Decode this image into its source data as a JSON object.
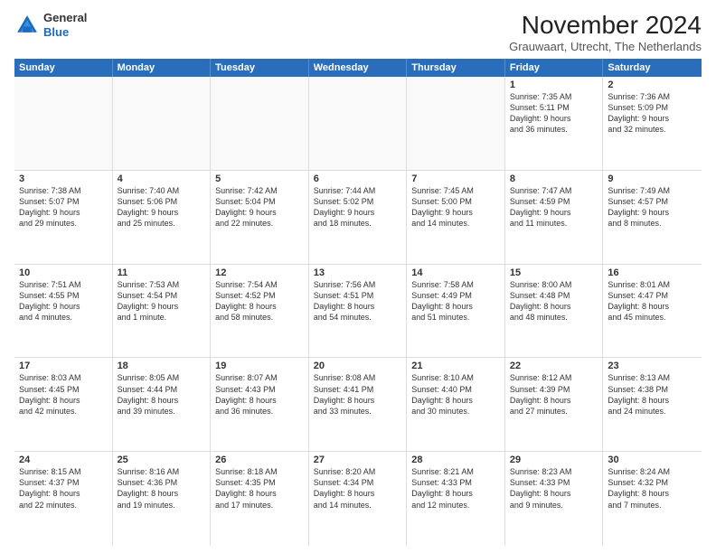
{
  "header": {
    "logo": {
      "line1": "General",
      "line2": "Blue"
    },
    "month_title": "November 2024",
    "subtitle": "Grauwaart, Utrecht, The Netherlands"
  },
  "weekdays": [
    "Sunday",
    "Monday",
    "Tuesday",
    "Wednesday",
    "Thursday",
    "Friday",
    "Saturday"
  ],
  "weeks": [
    [
      {
        "day": "",
        "info": ""
      },
      {
        "day": "",
        "info": ""
      },
      {
        "day": "",
        "info": ""
      },
      {
        "day": "",
        "info": ""
      },
      {
        "day": "",
        "info": ""
      },
      {
        "day": "1",
        "info": "Sunrise: 7:35 AM\nSunset: 5:11 PM\nDaylight: 9 hours\nand 36 minutes."
      },
      {
        "day": "2",
        "info": "Sunrise: 7:36 AM\nSunset: 5:09 PM\nDaylight: 9 hours\nand 32 minutes."
      }
    ],
    [
      {
        "day": "3",
        "info": "Sunrise: 7:38 AM\nSunset: 5:07 PM\nDaylight: 9 hours\nand 29 minutes."
      },
      {
        "day": "4",
        "info": "Sunrise: 7:40 AM\nSunset: 5:06 PM\nDaylight: 9 hours\nand 25 minutes."
      },
      {
        "day": "5",
        "info": "Sunrise: 7:42 AM\nSunset: 5:04 PM\nDaylight: 9 hours\nand 22 minutes."
      },
      {
        "day": "6",
        "info": "Sunrise: 7:44 AM\nSunset: 5:02 PM\nDaylight: 9 hours\nand 18 minutes."
      },
      {
        "day": "7",
        "info": "Sunrise: 7:45 AM\nSunset: 5:00 PM\nDaylight: 9 hours\nand 14 minutes."
      },
      {
        "day": "8",
        "info": "Sunrise: 7:47 AM\nSunset: 4:59 PM\nDaylight: 9 hours\nand 11 minutes."
      },
      {
        "day": "9",
        "info": "Sunrise: 7:49 AM\nSunset: 4:57 PM\nDaylight: 9 hours\nand 8 minutes."
      }
    ],
    [
      {
        "day": "10",
        "info": "Sunrise: 7:51 AM\nSunset: 4:55 PM\nDaylight: 9 hours\nand 4 minutes."
      },
      {
        "day": "11",
        "info": "Sunrise: 7:53 AM\nSunset: 4:54 PM\nDaylight: 9 hours\nand 1 minute."
      },
      {
        "day": "12",
        "info": "Sunrise: 7:54 AM\nSunset: 4:52 PM\nDaylight: 8 hours\nand 58 minutes."
      },
      {
        "day": "13",
        "info": "Sunrise: 7:56 AM\nSunset: 4:51 PM\nDaylight: 8 hours\nand 54 minutes."
      },
      {
        "day": "14",
        "info": "Sunrise: 7:58 AM\nSunset: 4:49 PM\nDaylight: 8 hours\nand 51 minutes."
      },
      {
        "day": "15",
        "info": "Sunrise: 8:00 AM\nSunset: 4:48 PM\nDaylight: 8 hours\nand 48 minutes."
      },
      {
        "day": "16",
        "info": "Sunrise: 8:01 AM\nSunset: 4:47 PM\nDaylight: 8 hours\nand 45 minutes."
      }
    ],
    [
      {
        "day": "17",
        "info": "Sunrise: 8:03 AM\nSunset: 4:45 PM\nDaylight: 8 hours\nand 42 minutes."
      },
      {
        "day": "18",
        "info": "Sunrise: 8:05 AM\nSunset: 4:44 PM\nDaylight: 8 hours\nand 39 minutes."
      },
      {
        "day": "19",
        "info": "Sunrise: 8:07 AM\nSunset: 4:43 PM\nDaylight: 8 hours\nand 36 minutes."
      },
      {
        "day": "20",
        "info": "Sunrise: 8:08 AM\nSunset: 4:41 PM\nDaylight: 8 hours\nand 33 minutes."
      },
      {
        "day": "21",
        "info": "Sunrise: 8:10 AM\nSunset: 4:40 PM\nDaylight: 8 hours\nand 30 minutes."
      },
      {
        "day": "22",
        "info": "Sunrise: 8:12 AM\nSunset: 4:39 PM\nDaylight: 8 hours\nand 27 minutes."
      },
      {
        "day": "23",
        "info": "Sunrise: 8:13 AM\nSunset: 4:38 PM\nDaylight: 8 hours\nand 24 minutes."
      }
    ],
    [
      {
        "day": "24",
        "info": "Sunrise: 8:15 AM\nSunset: 4:37 PM\nDaylight: 8 hours\nand 22 minutes."
      },
      {
        "day": "25",
        "info": "Sunrise: 8:16 AM\nSunset: 4:36 PM\nDaylight: 8 hours\nand 19 minutes."
      },
      {
        "day": "26",
        "info": "Sunrise: 8:18 AM\nSunset: 4:35 PM\nDaylight: 8 hours\nand 17 minutes."
      },
      {
        "day": "27",
        "info": "Sunrise: 8:20 AM\nSunset: 4:34 PM\nDaylight: 8 hours\nand 14 minutes."
      },
      {
        "day": "28",
        "info": "Sunrise: 8:21 AM\nSunset: 4:33 PM\nDaylight: 8 hours\nand 12 minutes."
      },
      {
        "day": "29",
        "info": "Sunrise: 8:23 AM\nSunset: 4:33 PM\nDaylight: 8 hours\nand 9 minutes."
      },
      {
        "day": "30",
        "info": "Sunrise: 8:24 AM\nSunset: 4:32 PM\nDaylight: 8 hours\nand 7 minutes."
      }
    ]
  ]
}
